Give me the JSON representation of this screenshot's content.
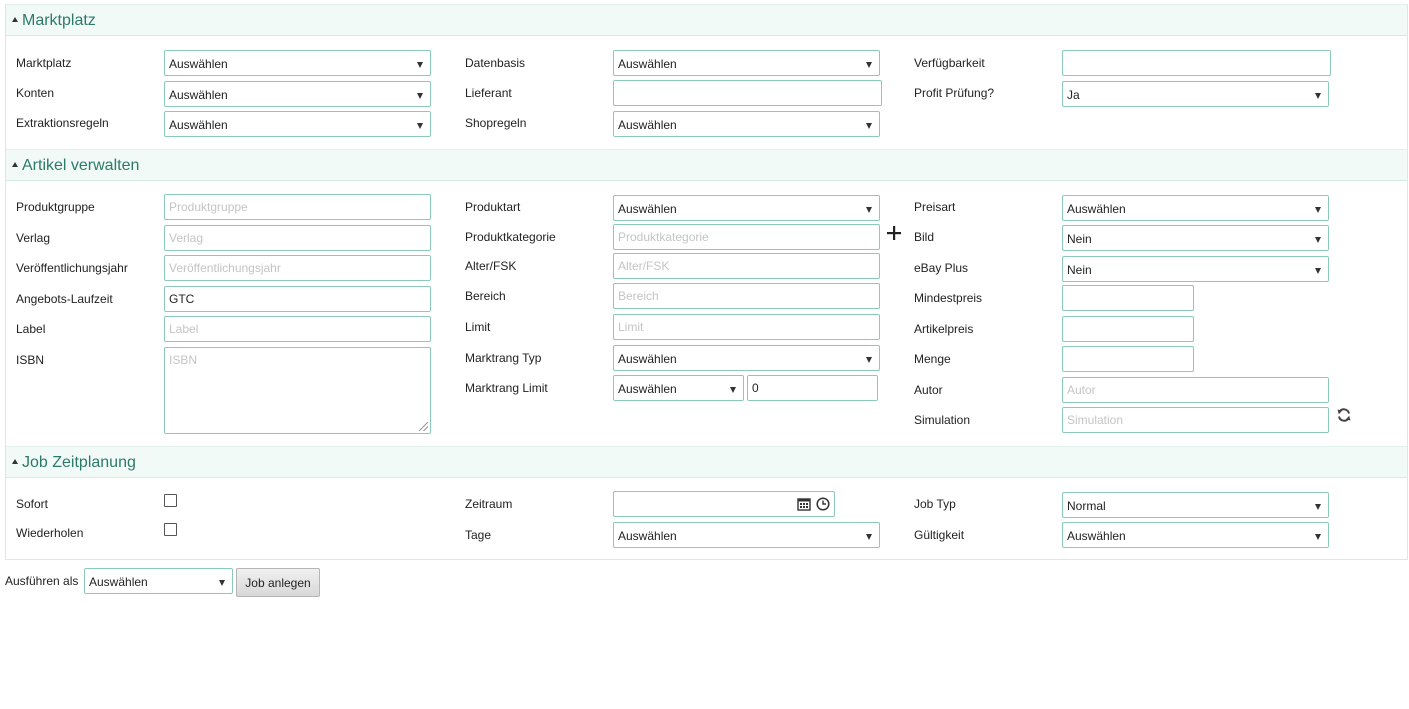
{
  "sections": {
    "marktplatz": {
      "title": "Marktplatz",
      "marktplatz_label": "Marktplatz",
      "marktplatz_value": "Auswählen",
      "konten_label": "Konten",
      "konten_value": "Auswählen",
      "extraktionsregeln_label": "Extraktionsregeln",
      "extraktionsregeln_value": "Auswählen",
      "datenbasis_label": "Datenbasis",
      "datenbasis_value": "Auswählen",
      "lieferant_label": "Lieferant",
      "lieferant_value": "",
      "shopregeln_label": "Shopregeln",
      "shopregeln_value": "Auswählen",
      "verfuegbarkeit_label": "Verfügbarkeit",
      "verfuegbarkeit_value": "",
      "profit_label": "Profit Prüfung?",
      "profit_value": "Ja"
    },
    "artikel": {
      "title": "Artikel verwalten",
      "produktgruppe_label": "Produktgruppe",
      "produktgruppe_placeholder": "Produktgruppe",
      "verlag_label": "Verlag",
      "verlag_placeholder": "Verlag",
      "veroeffentlichungsjahr_label": "Veröffentlichungsjahr",
      "veroeffentlichungsjahr_placeholder": "Veröffentlichungsjahr",
      "laufzeit_label": "Angebots-Laufzeit",
      "laufzeit_value": "GTC",
      "label_label": "Label",
      "label_placeholder": "Label",
      "isbn_label": "ISBN",
      "isbn_placeholder": "ISBN",
      "produktart_label": "Produktart",
      "produktart_value": "Auswählen",
      "produktkategorie_label": "Produktkategorie",
      "produktkategorie_placeholder": "Produktkategorie",
      "alter_label": "Alter/FSK",
      "alter_placeholder": "Alter/FSK",
      "bereich_label": "Bereich",
      "bereich_placeholder": "Bereich",
      "limit_label": "Limit",
      "limit_placeholder": "Limit",
      "marktrang_typ_label": "Marktrang Typ",
      "marktrang_typ_value": "Auswählen",
      "marktrang_limit_label": "Marktrang Limit",
      "marktrang_limit_select": "Auswählen",
      "marktrang_limit_value": "0",
      "add_icon": "plus-icon",
      "preisart_label": "Preisart",
      "preisart_value": "Auswählen",
      "bild_label": "Bild",
      "bild_value": "Nein",
      "ebay_plus_label": "eBay Plus",
      "ebay_plus_value": "Nein",
      "mindestpreis_label": "Mindestpreis",
      "mindestpreis_value": "",
      "artikelpreis_label": "Artikelpreis",
      "artikelpreis_value": "",
      "menge_label": "Menge",
      "menge_value": "",
      "autor_label": "Autor",
      "autor_placeholder": "Autor",
      "simulation_label": "Simulation",
      "simulation_placeholder": "Simulation",
      "refresh_icon": "refresh-icon"
    },
    "job": {
      "title": "Job Zeitplanung",
      "sofort_label": "Sofort",
      "wiederholen_label": "Wiederholen",
      "zeitraum_label": "Zeitraum",
      "zeitraum_value": "",
      "tage_label": "Tage",
      "tage_value": "Auswählen",
      "jobtyp_label": "Job Typ",
      "jobtyp_value": "Normal",
      "gueltigkeit_label": "Gültigkeit",
      "gueltigkeit_value": "Auswählen"
    }
  },
  "footer": {
    "ausfuehren_label": "Ausführen als",
    "ausfuehren_value": "Auswählen",
    "submit_label": "Job anlegen"
  },
  "colors": {
    "accent": "#2e7a68",
    "border": "#8ccab8",
    "section_bg": "#f1faf6"
  }
}
